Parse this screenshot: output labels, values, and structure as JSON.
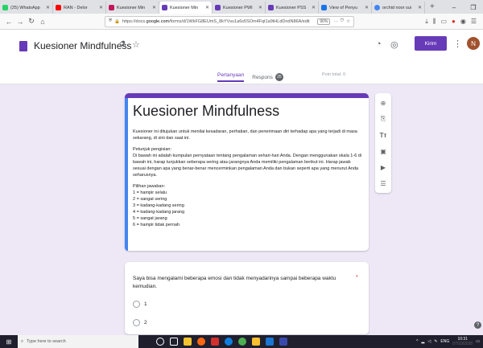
{
  "browser": {
    "tabs": [
      {
        "label": "(25) WhatsApp",
        "color": "#25d366"
      },
      {
        "label": "RAN - Delor",
        "color": "#ff0000"
      },
      {
        "label": "Kuesioner Min",
        "color": "#c2185b"
      },
      {
        "label": "Kuesioner Min",
        "color": "#673ab7"
      },
      {
        "label": "Kuesioner PWI",
        "color": "#673ab7"
      },
      {
        "label": "Kuesioner PSS",
        "color": "#673ab7"
      },
      {
        "label": "View of Penyu",
        "color": "#1a73e8"
      },
      {
        "label": "orchid noor sui",
        "color": "#4285f4"
      }
    ],
    "url_prefix": "https://docs.",
    "url_domain": "google.com",
    "url_suffix": "/forms/d/1WkFG8EUmS_8kYVsu1a6s5SOm4Fqt1a9tHLdDndN86A/edit",
    "zoom": "90%"
  },
  "header": {
    "doc_title": "Kuesioner Mindfulness",
    "send_label": "Kirim",
    "avatar_letter": "N"
  },
  "tabs": {
    "questions": "Pertanyaan",
    "responses": "Respons",
    "responses_count": "25",
    "points": "Poin total: 0"
  },
  "form": {
    "title": "Kuesioner Mindfulness",
    "intro": "Kuesioner ini ditujukan untuk menilai kesadaran, perhatian, dan penerimaan diri terhadap apa yang terjadi di masa sekarang, di sini dan saat ini.",
    "instructions_heading": "Petunjuk pengisian:",
    "instructions": "Di bawah ini adalah kumpulan pernyataan tentang pengalaman sehari-hari Anda. Dengan menggunakan skala 1-6 di bawah ini, harap tunjukkan seberapa sering atau jarangnya Anda memiliki pengalaman berikut ini. Harap jawab sesuai dengan apa yang benar-benar mencerminkan pengalaman Anda dan bukan seperti apa yang menurut Anda seharusnya.",
    "options_heading": "Pilihan jawaban:",
    "options": [
      "1 = hampir selalu",
      "2 = sangat sering",
      "3 = kadang-kadang sering",
      "4 = kadang-kadang jarang",
      "5 = sangat jarang",
      "6 = hampir tidak pernah"
    ]
  },
  "question": {
    "text": "Saya bisa mengalami beberapa emosi dan tidak menyadarinya sampai beberapa waktu kemudian.",
    "required_mark": "*",
    "choices": [
      "1",
      "2"
    ]
  },
  "taskbar": {
    "search_placeholder": "Type here to search",
    "lang": "ENG",
    "time": "10:31",
    "date": "07/10/2020"
  }
}
